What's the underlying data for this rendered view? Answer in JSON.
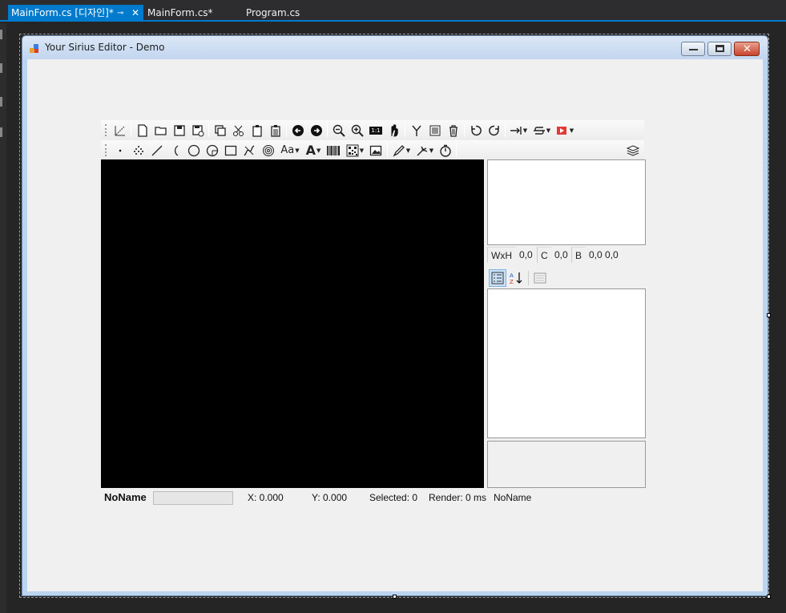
{
  "ide": {
    "tabs": [
      {
        "label": "MainForm.cs [디자인]*",
        "active": true
      },
      {
        "label": "MainForm.cs*",
        "active": false
      },
      {
        "label": "Program.cs",
        "active": false
      }
    ],
    "pin_glyph": "⊸",
    "close_glyph": "✕",
    "accent_color": "#007acc"
  },
  "form": {
    "title": "Your Sirius Editor - Demo",
    "caption_buttons": {
      "minimize": "—",
      "maximize": "□",
      "close": "✕"
    }
  },
  "toolbar_top": {
    "icons": [
      "axis-icon",
      "new-file-icon",
      "open-folder-icon",
      "save-icon",
      "save-as-icon",
      "copy-icon",
      "cut-icon",
      "paste-icon",
      "paste-array-icon",
      "arrow-left-icon",
      "arrow-right-icon",
      "zoom-out-icon",
      "zoom-in-icon",
      "zoom-fit-icon",
      "pan-hand-icon",
      "merge-icon",
      "list-icon",
      "delete-icon",
      "rotate-ccw-icon",
      "rotate-cw-icon",
      "align-icon",
      "snap-icon",
      "video-icon"
    ],
    "labels": {
      "zoom_fit": "1:1"
    }
  },
  "toolbar_bottom": {
    "icons": [
      "point-icon",
      "points-icon",
      "line-icon",
      "arc-icon",
      "circle-icon",
      "trepan-icon",
      "rectangle-icon",
      "spiral-icon",
      "spiral-circles-icon",
      "text-icon",
      "sirius-text-icon",
      "barcode-icon",
      "qr-code-icon",
      "image-icon",
      "pen-icon",
      "laser-icon",
      "timer-icon",
      "layers-icon"
    ],
    "labels": {
      "text": "Aa",
      "font": "A"
    }
  },
  "canvas": {
    "background": "#000000"
  },
  "info": {
    "size_label": "WxH",
    "size_value": "0,0",
    "center_label": "C",
    "center_value": "0,0",
    "bound_label": "B",
    "bound_value": "0,0 0,0"
  },
  "property_grid": {
    "buttons": [
      "categorized-icon",
      "alphabetical-icon",
      "property-pages-icon"
    ],
    "alpha_label": "AZ"
  },
  "status": {
    "document": "NoName",
    "progress": 0,
    "x": "X: 0.000",
    "y": "Y: 0.000",
    "selected": "Selected: 0",
    "render": "Render: 0 ms",
    "filename": "NoName"
  }
}
